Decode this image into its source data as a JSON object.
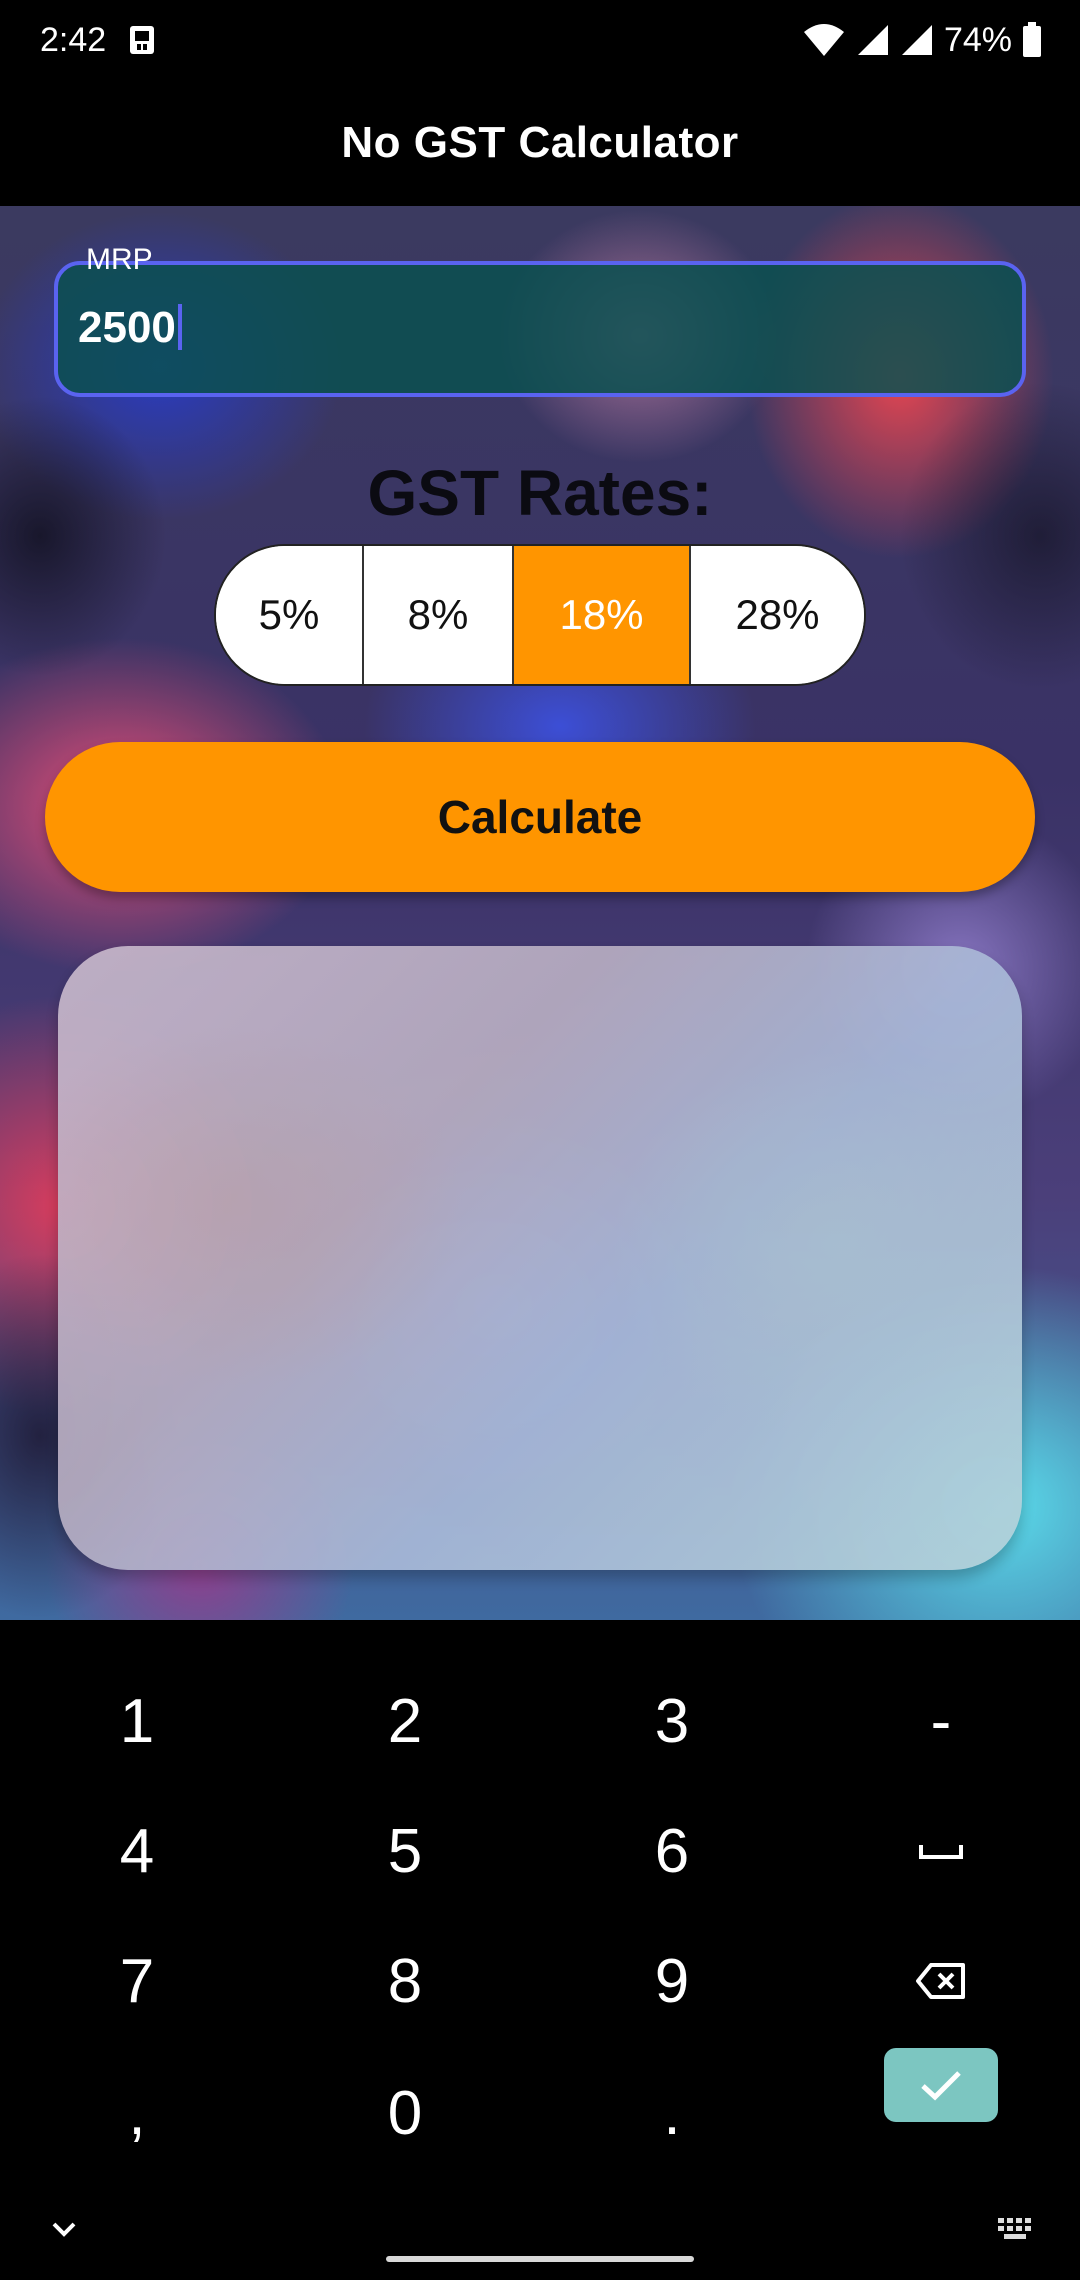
{
  "status_bar": {
    "time": "2:42",
    "battery_percent": "74%",
    "icons": [
      "notification-app-icon",
      "wifi-icon",
      "signal-icon",
      "signal-icon",
      "battery-icon"
    ]
  },
  "app_bar": {
    "title": "No GST Calculator"
  },
  "mrp_input": {
    "label": "MRP",
    "value": "2500"
  },
  "gst": {
    "heading": "GST Rates:",
    "rates": [
      "5%",
      "8%",
      "18%",
      "28%"
    ],
    "selected": "18%"
  },
  "calculate_label": "Calculate",
  "keyboard": {
    "rows": [
      [
        "1",
        "2",
        "3",
        "-"
      ],
      [
        "4",
        "5",
        "6",
        "space"
      ],
      [
        "7",
        "8",
        "9",
        "backspace"
      ],
      [
        ",",
        "0",
        ".",
        "done"
      ]
    ],
    "icons": [
      "space-icon",
      "backspace-icon",
      "checkmark-icon",
      "chevron-down-icon",
      "keyboard-icon"
    ]
  },
  "colors": {
    "accent": "#ff9500",
    "input_border": "#5a63f0",
    "input_fill": "#0e5050",
    "done_key": "#7cc6c1",
    "background": "#000000"
  }
}
